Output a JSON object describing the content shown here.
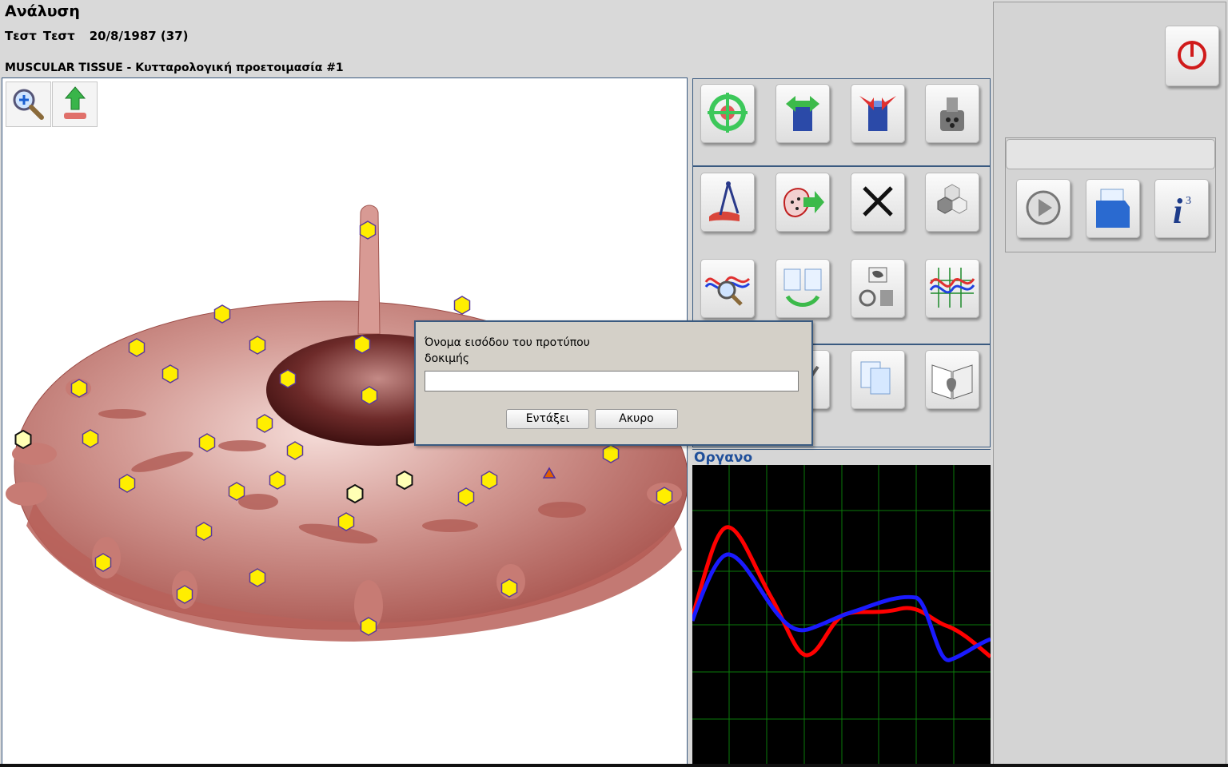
{
  "header": {
    "title": "Ανάλυση",
    "patient_first": "Τεστ",
    "patient_last": "Τεστ",
    "patient_dob": "20/8/1987 (37)",
    "tissue_title": "MUSCULAR TISSUE - Κυτταρολογική προετοιμασία #1"
  },
  "canvas": {
    "tools": [
      {
        "icon": "zoom-in-icon"
      },
      {
        "icon": "upload-icon"
      }
    ],
    "point_count_yellow": 34,
    "point_count_pale": 3
  },
  "tool_panel": {
    "buttons": [
      {
        "icon": "target-icon"
      },
      {
        "icon": "container-out-icon"
      },
      {
        "icon": "container-in-icon"
      },
      {
        "icon": "mortar-icon"
      },
      {
        "icon": "compass-icon"
      },
      {
        "icon": "cell-transfer-icon"
      },
      {
        "icon": "close-icon"
      },
      {
        "icon": "hexagons-icon"
      },
      {
        "icon": "wave-search-icon"
      },
      {
        "icon": "documents-refresh-icon"
      },
      {
        "icon": "organ-container-icon"
      },
      {
        "icon": "waveform-grid-icon"
      },
      {
        "icon": "document-edit-icon"
      },
      {
        "icon": "documents-icon"
      },
      {
        "icon": "book-heart-icon"
      }
    ]
  },
  "instrument": {
    "label": "Οργανο"
  },
  "right_panel": {
    "power_icon": "power-icon",
    "field_value": "",
    "buttons": [
      {
        "icon": "play-icon"
      },
      {
        "icon": "folder-icon"
      },
      {
        "icon": "info-icon"
      }
    ]
  },
  "dialog": {
    "prompt": "Όνομα εισόδου του προτύπου δοκιμής",
    "input_value": "",
    "ok_label": "Εντάξει",
    "cancel_label": "Ακυρο"
  },
  "colors": {
    "accent": "#1f4f9a",
    "series_red": "#ff0000",
    "series_blue": "#1a1aff",
    "grid": "#0a7a0a",
    "marker": "#ffee00"
  }
}
